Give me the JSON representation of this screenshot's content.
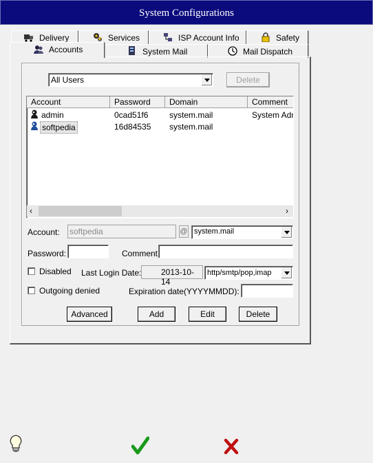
{
  "window": {
    "title": "System Configurations"
  },
  "tabs_back": [
    {
      "label": "Delivery",
      "icon": "truck-icon"
    },
    {
      "label": "Services",
      "icon": "gears-icon"
    },
    {
      "label": "ISP Account Info",
      "icon": "network-icon"
    },
    {
      "label": "Safety",
      "icon": "padlock-icon"
    }
  ],
  "tabs_front": [
    {
      "label": "Accounts",
      "icon": "users-icon",
      "selected": true
    },
    {
      "label": "System Mail",
      "icon": "server-mail-icon"
    },
    {
      "label": "Mail Dispatch",
      "icon": "clock-icon"
    }
  ],
  "filter": {
    "value": "All Users"
  },
  "delete_top_label": "Delete",
  "list": {
    "columns": [
      "Account",
      "Password",
      "Domain",
      "Comment"
    ],
    "rows": [
      {
        "account": "admin",
        "password": "0cad51f6",
        "domain": "system.mail",
        "comment": "System Admi",
        "icon": "admin-user-icon"
      },
      {
        "account": "softpedia",
        "password": "16d84535",
        "domain": "system.mail",
        "comment": "",
        "icon": "user-icon",
        "selected": true
      }
    ]
  },
  "form": {
    "account_label": "Account:",
    "account_value": "softpedia",
    "at_symbol": "@",
    "domain_value": "system.mail",
    "password_label": "Password:",
    "password_value": "",
    "comment_label": "Comment:",
    "comment_value": "",
    "disabled_label": "Disabled",
    "last_login_label": "Last Login Date:",
    "last_login_value": "2013-10-14",
    "protocols_value": "http/smtp/pop,imap",
    "outgoing_denied_label": "Outgoing denied",
    "expiration_label": "Expiration date(YYYYMMDD):",
    "expiration_value": ""
  },
  "buttons": {
    "advanced": "Advanced",
    "add": "Add",
    "edit": "Edit",
    "delete": "Delete"
  },
  "footer": {
    "hint_icon": "lightbulb-icon",
    "ok_icon": "checkmark-icon",
    "cancel_icon": "red-x-icon"
  },
  "colors": {
    "titlebar": "#0b0b7e",
    "ok_green": "#1a9a1a",
    "cancel_red": "#c01010"
  }
}
